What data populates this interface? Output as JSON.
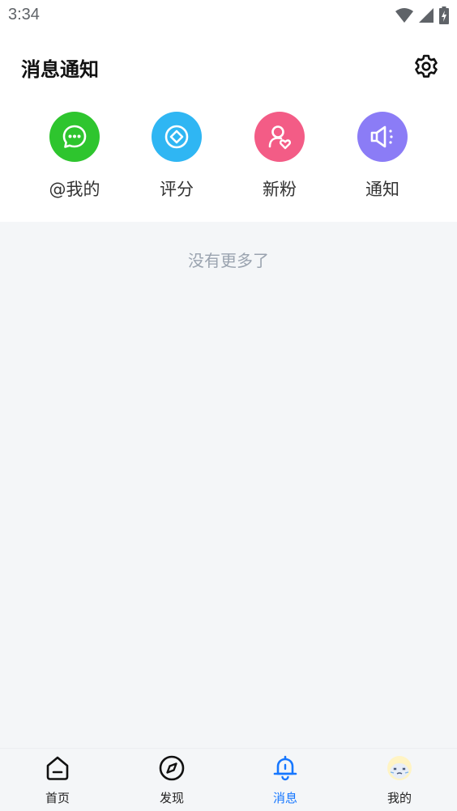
{
  "status_bar": {
    "time": "3:34"
  },
  "header": {
    "title": "消息通知"
  },
  "categories": [
    {
      "label": "@我的",
      "icon": "chat-bubble-icon",
      "color": "#2ec52e"
    },
    {
      "label": "评分",
      "icon": "rating-icon",
      "color": "#2fb6f3"
    },
    {
      "label": "新粉",
      "icon": "new-follower-icon",
      "color": "#f35c86"
    },
    {
      "label": "通知",
      "icon": "megaphone-icon",
      "color": "#8b7cf6"
    }
  ],
  "content": {
    "empty_text": "没有更多了"
  },
  "bottom_nav": {
    "items": [
      {
        "label": "首页",
        "icon": "home-icon"
      },
      {
        "label": "发现",
        "icon": "compass-icon"
      },
      {
        "label": "消息",
        "icon": "bell-icon",
        "active": true
      },
      {
        "label": "我的",
        "icon": "avatar-icon"
      }
    ],
    "active_color": "#1677ff"
  }
}
